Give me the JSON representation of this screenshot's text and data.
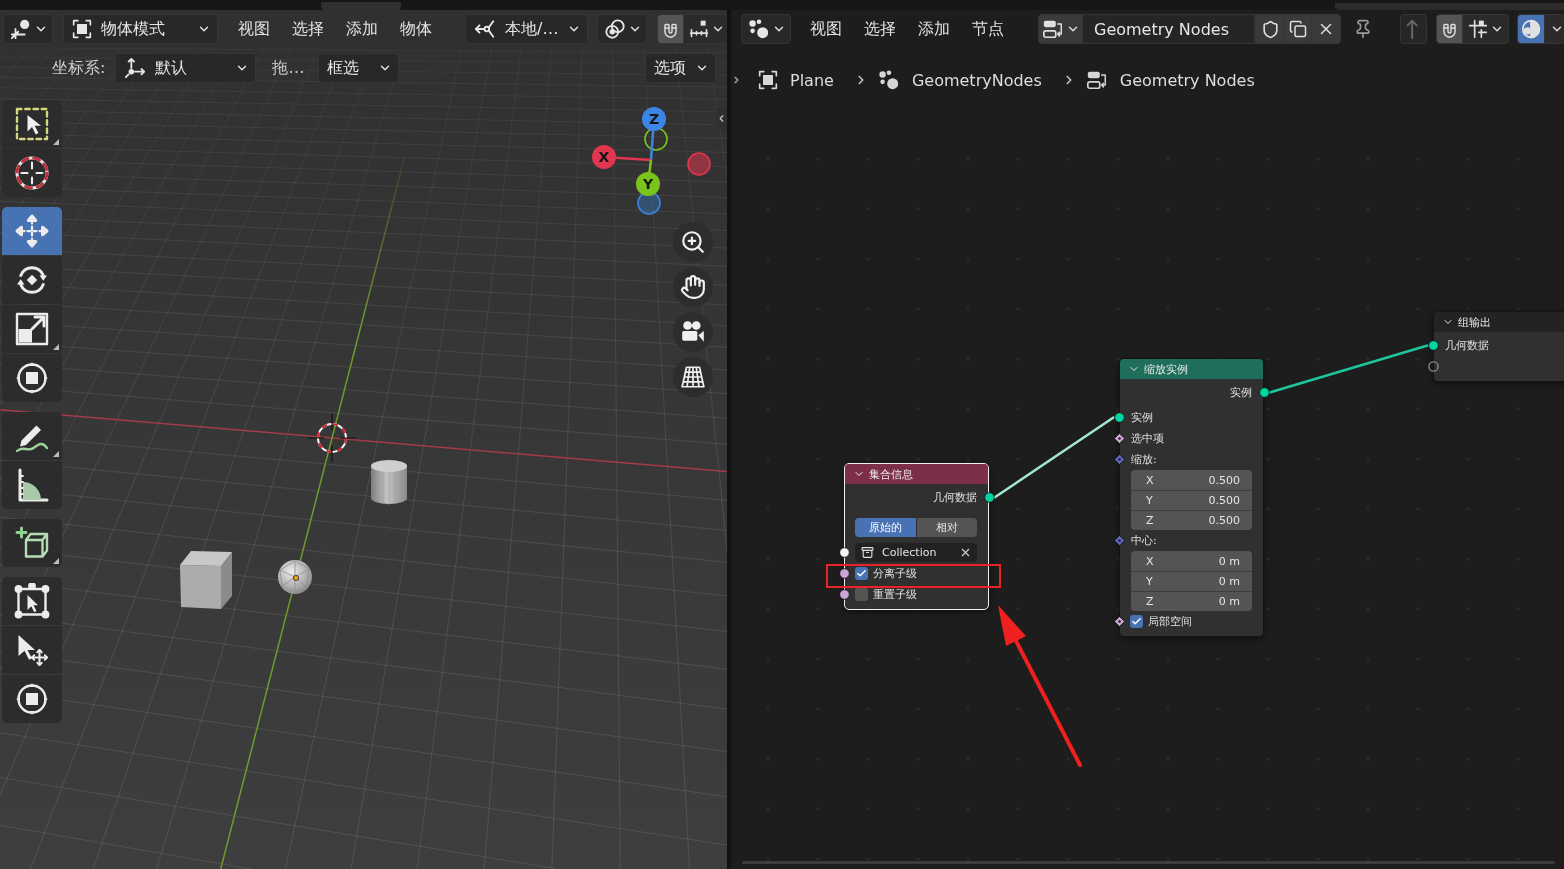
{
  "viewport": {
    "header": {
      "mode": "物体模式",
      "menus": [
        "视图",
        "选择",
        "添加",
        "物体"
      ],
      "orientation": "本地/…",
      "snap": {
        "on": true
      }
    },
    "tool_settings": {
      "orientation_label": "坐标系:",
      "orientation_value": "默认",
      "drag_label": "拖…",
      "drag_value": "框选",
      "options": "选项"
    },
    "tool_groups": [
      {
        "tools": [
          {
            "kind": "select_box",
            "selected": false,
            "variants": true
          },
          {
            "kind": "cursor",
            "selected": false,
            "variants": false
          }
        ]
      },
      {
        "tools": [
          {
            "kind": "move",
            "selected": true,
            "variants": false
          },
          {
            "kind": "rotate",
            "selected": false,
            "variants": false
          },
          {
            "kind": "scale",
            "selected": false,
            "variants": true
          },
          {
            "kind": "transform",
            "selected": false,
            "variants": false
          }
        ]
      },
      {
        "tools": [
          {
            "kind": "annotate",
            "selected": false,
            "variants": true
          },
          {
            "kind": "measure",
            "selected": false,
            "variants": false
          }
        ]
      },
      {
        "tools": [
          {
            "kind": "add_cube",
            "selected": false,
            "variants": true
          }
        ]
      },
      {
        "tools": [
          {
            "kind": "cage",
            "selected": false,
            "variants": false
          },
          {
            "kind": "pointer_move",
            "selected": false,
            "variants": false
          },
          {
            "kind": "transform",
            "selected": false,
            "variants": false
          }
        ]
      }
    ],
    "gizmo": {
      "axes": [
        {
          "label": "Z",
          "color": "#3b86e4"
        },
        {
          "label": "X",
          "color": "#e0364f"
        },
        {
          "label": "Y",
          "color": "#7ac51b"
        }
      ]
    },
    "nav_buttons": [
      {
        "kind": "zoom"
      },
      {
        "kind": "pan"
      },
      {
        "kind": "camera"
      },
      {
        "kind": "perspective"
      }
    ]
  },
  "node_editor": {
    "header": {
      "menus": [
        "视图",
        "选择",
        "添加",
        "节点"
      ],
      "node_group": "Geometry Nodes",
      "snap": {
        "on": true
      },
      "parent": {
        "disabled": true
      },
      "overlays": {
        "on": true
      }
    },
    "breadcrumbs": [
      {
        "kind": "object",
        "label": "Plane"
      },
      {
        "kind": "modifier",
        "label": "GeometryNodes"
      },
      {
        "kind": "node_group",
        "label": "Geometry Nodes"
      }
    ],
    "nodes": [
      {
        "kind": "collection_info",
        "title": "集合信息",
        "color": "#7e2f48",
        "selected": true,
        "expanded": true,
        "rows": [
          {
            "kind": "output",
            "label": "几何数据",
            "socket": {
              "kind": "geometry"
            }
          },
          {
            "kind": "enum",
            "options": [
              {
                "label": "原始的",
                "selected": true
              },
              {
                "label": "相对",
                "selected": false
              }
            ]
          },
          {
            "kind": "object",
            "value": "Collection",
            "socket": {
              "kind": "collection"
            }
          },
          {
            "kind": "checkbox",
            "label": "分离子级",
            "checked": true,
            "socket": {
              "kind": "boolean"
            },
            "highlighted": true
          },
          {
            "kind": "checkbox",
            "label": "重置子级",
            "checked": false,
            "socket": {
              "kind": "boolean"
            },
            "highlighted": false
          }
        ]
      },
      {
        "kind": "scale_instances",
        "title": "缩放实例",
        "color": "#1f6e5b",
        "selected": false,
        "expanded": true,
        "rows": [
          {
            "kind": "output",
            "label": "实例",
            "socket": {
              "kind": "geometry"
            }
          },
          {
            "kind": "input",
            "label": "实例",
            "socket": {
              "kind": "geometry"
            }
          },
          {
            "kind": "input",
            "label": "选中项",
            "socket": {
              "kind": "boolean_field"
            }
          },
          {
            "kind": "vector",
            "label": "缩放:",
            "socket": {
              "kind": "vector_field"
            },
            "components": [
              {
                "axis": "X",
                "value": "0.500"
              },
              {
                "axis": "Y",
                "value": "0.500"
              },
              {
                "axis": "Z",
                "value": "0.500"
              }
            ]
          },
          {
            "kind": "vector",
            "label": "中心:",
            "socket": {
              "kind": "vector_field"
            },
            "components": [
              {
                "axis": "X",
                "value": "0 m"
              },
              {
                "axis": "Y",
                "value": "0 m"
              },
              {
                "axis": "Z",
                "value": "0 m"
              }
            ]
          },
          {
            "kind": "checkbox",
            "label": "局部空间",
            "checked": true,
            "socket": {
              "kind": "boolean_field"
            },
            "highlighted": false
          }
        ]
      },
      {
        "kind": "group_output",
        "title": "组输出",
        "color": "#232323",
        "selected": false,
        "expanded": true,
        "rows": [
          {
            "kind": "input",
            "label": "几何数据",
            "socket": {
              "kind": "geometry"
            }
          },
          {
            "kind": "input",
            "socket": {
              "kind": "virtual"
            }
          }
        ]
      }
    ]
  }
}
